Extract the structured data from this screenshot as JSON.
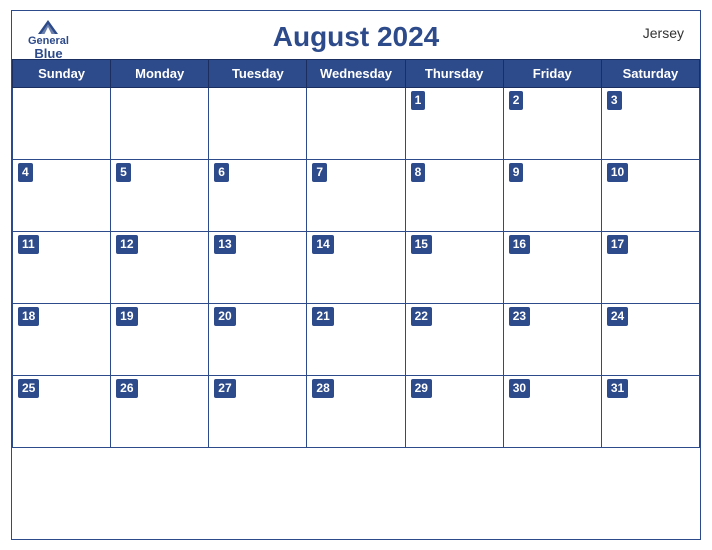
{
  "calendar": {
    "title": "August 2024",
    "region": "Jersey",
    "logo": {
      "general": "General",
      "blue": "Blue"
    },
    "dayHeaders": [
      "Sunday",
      "Monday",
      "Tuesday",
      "Wednesday",
      "Thursday",
      "Friday",
      "Saturday"
    ],
    "weeks": [
      [
        null,
        null,
        null,
        null,
        1,
        2,
        3
      ],
      [
        4,
        5,
        6,
        7,
        8,
        9,
        10
      ],
      [
        11,
        12,
        13,
        14,
        15,
        16,
        17
      ],
      [
        18,
        19,
        20,
        21,
        22,
        23,
        24
      ],
      [
        25,
        26,
        27,
        28,
        29,
        30,
        31
      ]
    ]
  }
}
